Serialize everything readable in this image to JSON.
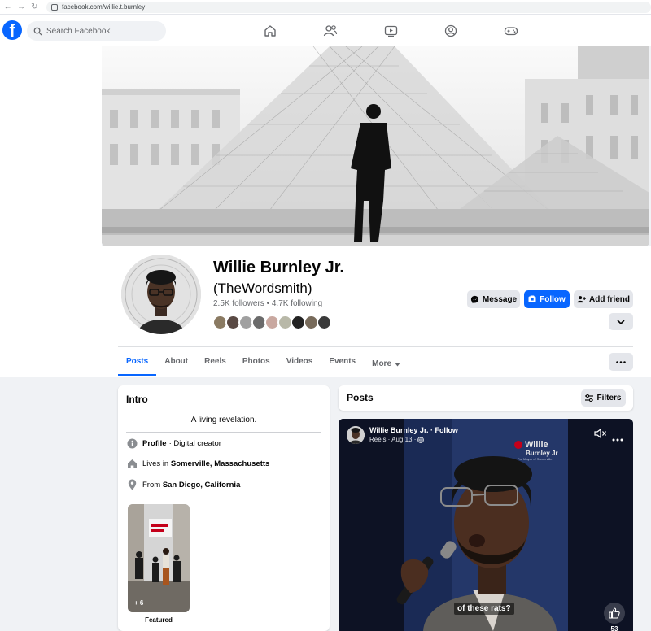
{
  "browser": {
    "url": "facebook.com/willie.t.burnley"
  },
  "header": {
    "search_placeholder": "Search Facebook",
    "logo": "f"
  },
  "profile": {
    "name": "Willie Burnley Jr.",
    "alt_name": "(TheWordsmith)",
    "stats": "2.5K followers • 4.7K following",
    "buttons": {
      "message": "Message",
      "follow": "Follow",
      "add_friend": "Add friend"
    }
  },
  "tabs": [
    "Posts",
    "About",
    "Reels",
    "Photos",
    "Videos",
    "Events",
    "More"
  ],
  "intro": {
    "title": "Intro",
    "bio": "A living revelation.",
    "profile_label": "Profile",
    "profile_value": "· Digital creator",
    "lives_prefix": "Lives in ",
    "lives_city": "Somerville, Massachusetts",
    "from_prefix": "From ",
    "from_city": "San Diego, California",
    "featured_count": "+ 6",
    "featured_label": "Featured"
  },
  "posts": {
    "title": "Posts",
    "filters": "Filters",
    "reel": {
      "author": "Willie Burnley Jr. · Follow",
      "meta": "Reels · Aug 13 ·",
      "watermark_line1": "Willie",
      "watermark_line2": "Burnley Jr",
      "watermark_line3": "For Mayor of Somerville",
      "caption": "of these rats?",
      "likes": "53"
    }
  },
  "colors": {
    "brand": "#0866ff",
    "bg": "#f0f2f5",
    "text": "#050505",
    "muted": "#65676b"
  }
}
